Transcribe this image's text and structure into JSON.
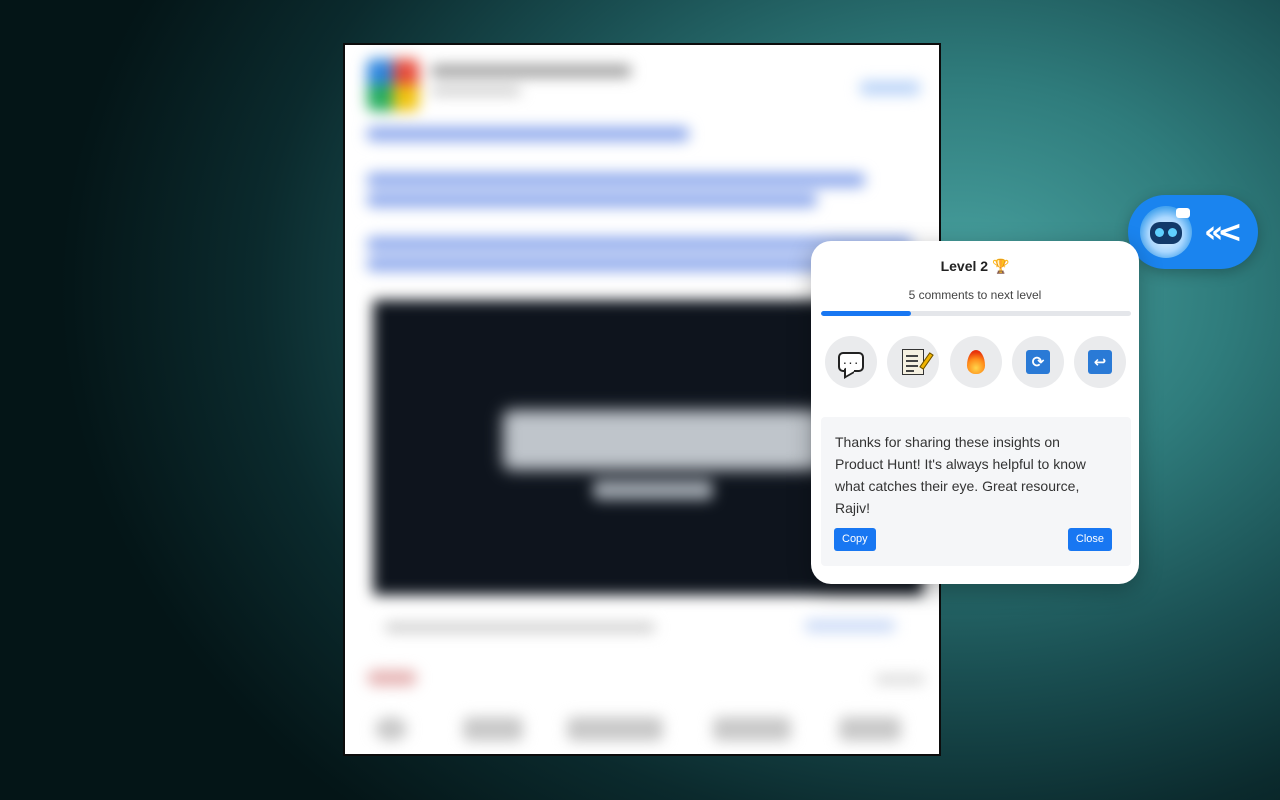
{
  "panel": {
    "level_label": "Level 2",
    "trophy_glyph": "🏆",
    "next_level_text": "5 comments to next level",
    "progress_fraction": 0.29,
    "actions": [
      {
        "name": "comment-icon"
      },
      {
        "name": "memo-icon"
      },
      {
        "name": "fire-icon"
      },
      {
        "name": "refresh-icon",
        "glyph": "⟳"
      },
      {
        "name": "return-icon",
        "glyph": "↩"
      }
    ],
    "reply_text": "Thanks for sharing these insights on Product Hunt! It's always helpful to know what catches their eye. Great resource, Rajiv!",
    "copy_label": "Copy",
    "close_label": "Close"
  },
  "launcher": {
    "chevron_glyph": "«<"
  },
  "colors": {
    "accent": "#1877f2",
    "launcher_bg": "#1a84ef",
    "panel_bg": "#ffffff",
    "reply_bg": "#f5f6f8",
    "action_bg": "#eaebed"
  }
}
